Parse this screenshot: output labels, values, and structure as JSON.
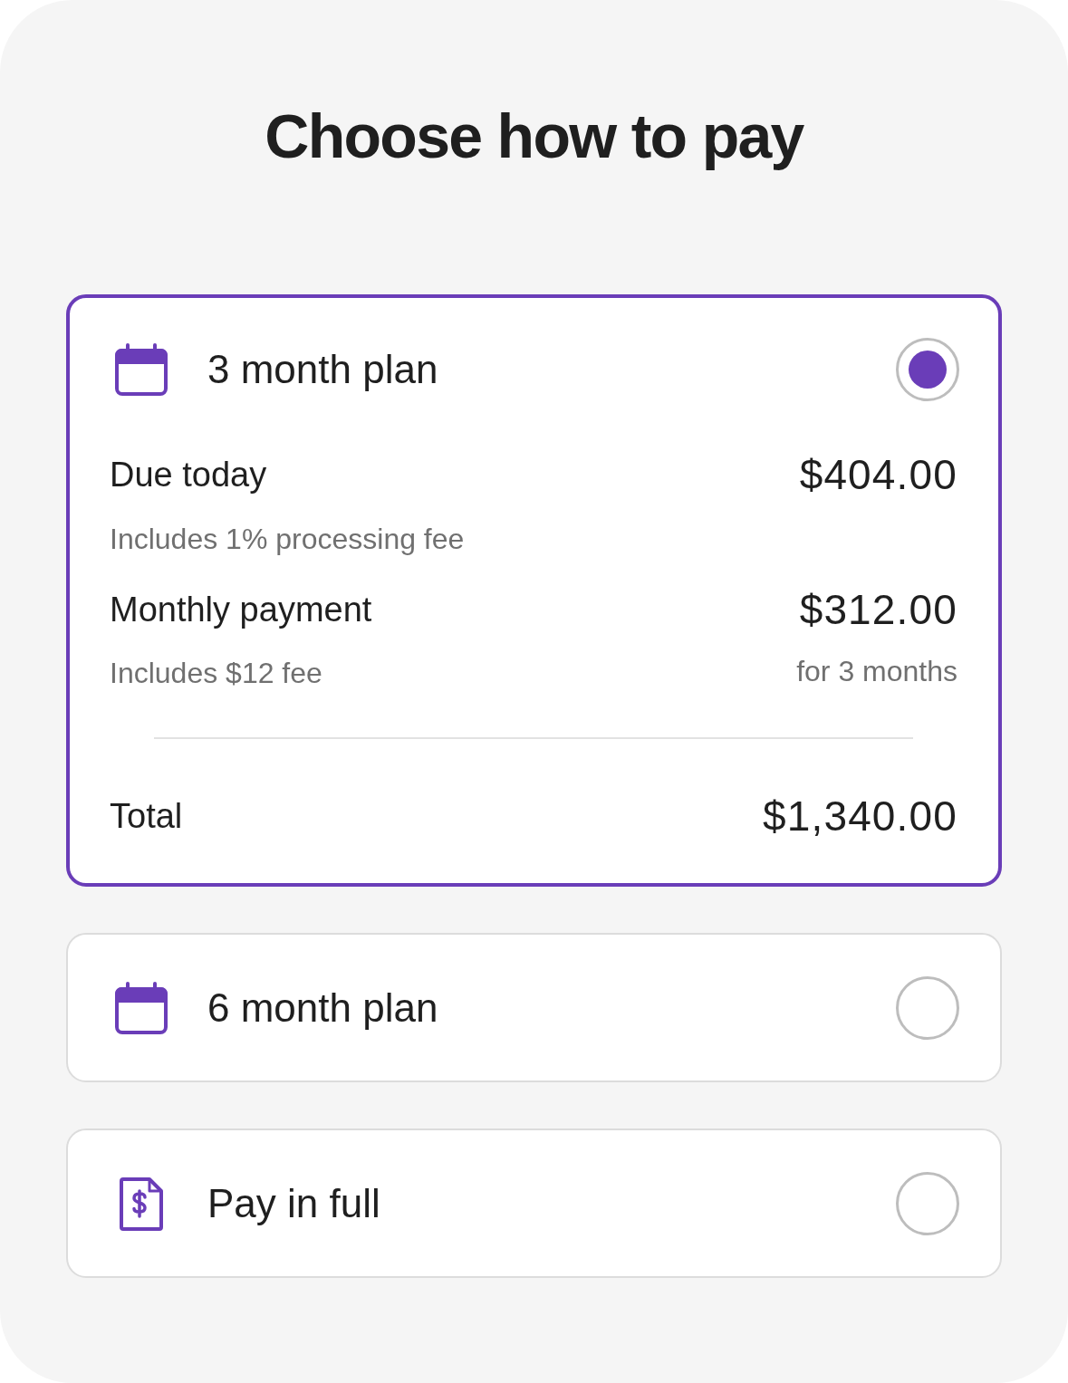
{
  "title": "Choose how to pay",
  "options": [
    {
      "kind": "plan",
      "label": "3 month plan",
      "selected": true,
      "details": {
        "lines": [
          {
            "label": "Due today",
            "amount": "$404.00",
            "note": "Includes 1% processing fee"
          },
          {
            "label": "Monthly payment",
            "amount": "$312.00",
            "note": "Includes $12 fee",
            "amount_note": "for 3 months"
          }
        ],
        "total": {
          "label": "Total",
          "amount": "$1,340.00"
        }
      }
    },
    {
      "kind": "plan",
      "label": "6 month plan",
      "selected": false
    },
    {
      "kind": "full",
      "label": "Pay in full",
      "selected": false
    }
  ]
}
